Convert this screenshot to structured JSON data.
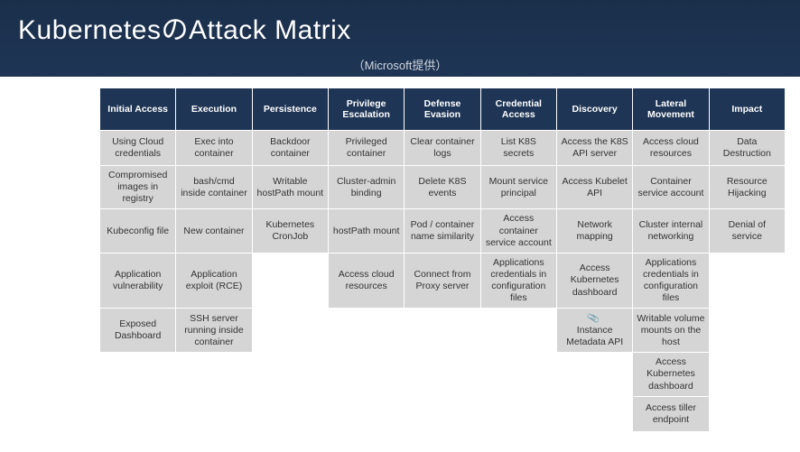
{
  "page": {
    "title": "KubernetesのAttack Matrix",
    "subtitle": "（Microsoft提供）"
  },
  "matrix": {
    "headers": [
      "Initial Access",
      "Execution",
      "Persistence",
      "Privilege Escalation",
      "Defense Evasion",
      "Credential Access",
      "Discovery",
      "Lateral Movement",
      "Impact"
    ],
    "rows": [
      {
        "initial_access": "Using Cloud credentials",
        "execution": "Exec into container",
        "persistence": "Backdoor container",
        "priv_esc": "Privileged container",
        "defense_evasion": "Clear container logs",
        "credential_access": "List K8S secrets",
        "discovery": "Access the K8S API server",
        "lateral_movement": "Access cloud resources",
        "impact": "Data Destruction"
      },
      {
        "initial_access": "Compromised images in registry",
        "execution": "bash/cmd inside container",
        "persistence": "Writable hostPath mount",
        "priv_esc": "Cluster-admin binding",
        "defense_evasion": "Delete K8S events",
        "credential_access": "Mount service principal",
        "discovery": "Access Kubelet API",
        "lateral_movement": "Container service account",
        "impact": "Resource Hijacking"
      },
      {
        "initial_access": "Kubeconfig file",
        "execution": "New container",
        "persistence": "Kubernetes CronJob",
        "priv_esc": "hostPath mount",
        "defense_evasion": "Pod / container name similarity",
        "credential_access": "Access container service account",
        "discovery": "Network mapping",
        "lateral_movement": "Cluster internal networking",
        "impact": "Denial of service"
      },
      {
        "initial_access": "Application vulnerability",
        "execution": "Application exploit (RCE)",
        "persistence": "",
        "priv_esc": "Access cloud resources",
        "defense_evasion": "Connect from Proxy server",
        "credential_access": "Applications credentials in configuration files",
        "discovery": "Access Kubernetes dashboard",
        "lateral_movement": "Applications credentials in configuration files",
        "impact": ""
      },
      {
        "initial_access": "Exposed Dashboard",
        "execution": "SSH server running inside container",
        "persistence": "",
        "priv_esc": "",
        "defense_evasion": "",
        "credential_access": "",
        "discovery": "Instance Metadata API",
        "discovery_pin": "📎",
        "lateral_movement": "Writable volume mounts on the host",
        "impact": ""
      },
      {
        "lateral_movement": "Access Kubernetes dashboard"
      },
      {
        "lateral_movement": "Access tiller endpoint"
      }
    ]
  }
}
